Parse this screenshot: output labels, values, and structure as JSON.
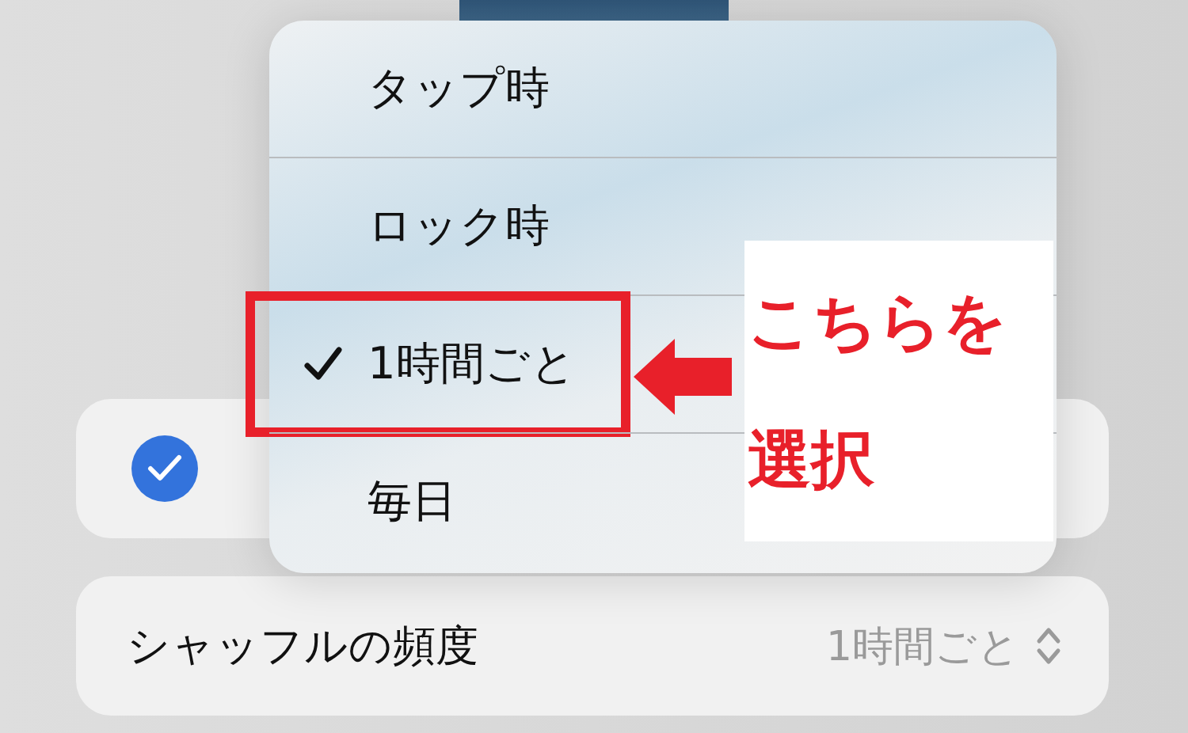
{
  "option_row": {
    "checked": true
  },
  "menu": {
    "items": [
      {
        "label": "タップ時",
        "selected": false,
        "highlighted": false
      },
      {
        "label": "ロック時",
        "selected": false,
        "highlighted": false
      },
      {
        "label": "1時間ごと",
        "selected": true,
        "highlighted": true
      },
      {
        "label": "毎日",
        "selected": false,
        "highlighted": false
      }
    ]
  },
  "shuffle_row": {
    "label": "シャッフルの頻度",
    "value": "1時間ごと"
  },
  "annotation": {
    "lines": [
      "こちらを",
      "選択"
    ]
  }
}
